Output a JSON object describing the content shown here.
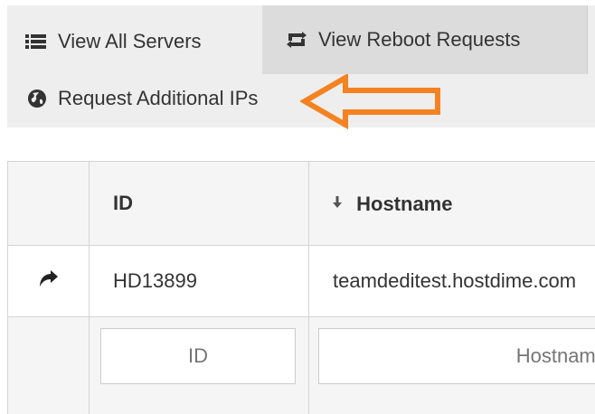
{
  "nav": {
    "view_all_servers": "View All Servers",
    "view_reboot_requests": "View Reboot Requests",
    "request_additional_ips": "Request Additional IPs"
  },
  "icons": {
    "list": "list-icon",
    "reboot": "retweet-icon",
    "globe": "globe-icon",
    "sort": "sort-down-icon",
    "action": "share-arrow-icon"
  },
  "annotation": {
    "arrow_color": "#f58220",
    "points_to": "Request Additional IPs"
  },
  "table": {
    "columns": [
      "",
      "ID",
      "Hostname"
    ],
    "sorted_column": "Hostname",
    "rows": [
      {
        "id": "HD13899",
        "hostname": "teamdeditest.hostdime.com"
      }
    ],
    "filter_placeholders": {
      "id": "ID",
      "hostname": "Hostname"
    }
  }
}
